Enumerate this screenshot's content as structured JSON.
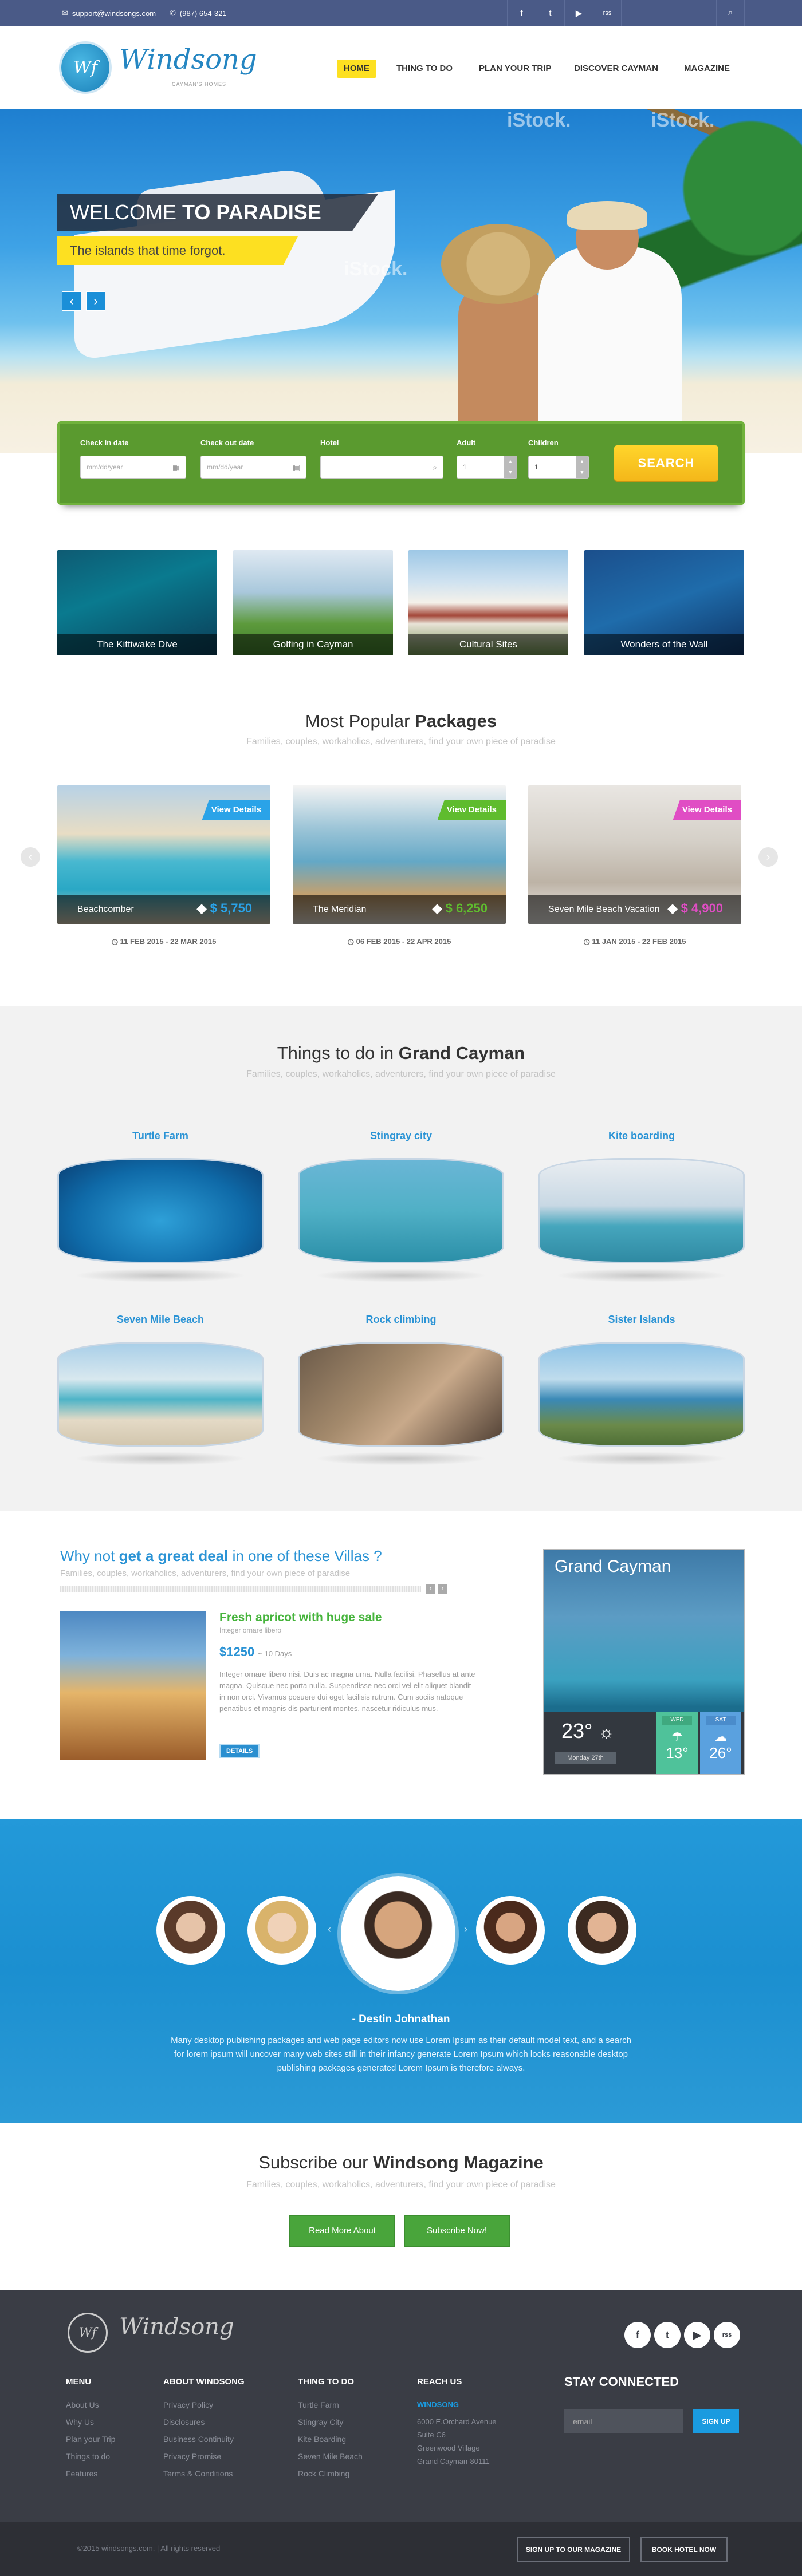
{
  "topbar": {
    "email": "support@windsongs.com",
    "phone": "(987) 654-321",
    "social": [
      "f",
      "t",
      "▶",
      "rss"
    ],
    "icons": {
      "social": [
        "facebook-icon",
        "twitter-icon",
        "youtube-icon",
        "rss-icon"
      ],
      "search": "search-icon"
    }
  },
  "header": {
    "logo_mark": "Wf",
    "logo_text": "Windsong",
    "logo_sub": "CAYMAN'S HOMES",
    "nav": [
      "HOME",
      "THING TO DO",
      "PLAN YOUR TRIP",
      "DISCOVER CAYMAN",
      "MAGAZINE"
    ],
    "active_nav": "HOME",
    "accent": "#fde021"
  },
  "hero": {
    "welcome": "WELCOME",
    "welcome_bold": "TO PARADISE",
    "tagline": "The islands that time forgot.",
    "watermarks": [
      "iStock.",
      "iStock.",
      "iStock."
    ]
  },
  "search": {
    "checkin_label": "Check in date",
    "checkin_placeholder": "mm/dd/year",
    "checkout_label": "Check out date",
    "checkout_placeholder": "mm/dd/year",
    "hotel_label": "Hotel",
    "adult_label": "Adult",
    "adult_value": "1",
    "children_label": "Children",
    "children_value": "1",
    "button": "SEARCH",
    "color": "#5a9a2f"
  },
  "tiles": [
    "The Kittiwake Dive",
    "Golfing in Cayman",
    "Cultural Sites",
    "Wonders of the Wall"
  ],
  "packages": {
    "title": "Most Popular",
    "title_bold": "Packages",
    "subtitle": "Families, couples, workaholics, adventurers, find your own piece of paradise",
    "items": [
      {
        "name": "Beachcomber",
        "price": "$ 5,750",
        "cta": "View Details",
        "dates": "11 FEB 2015 - 22 MAR 2015",
        "color": "#2aa3e8"
      },
      {
        "name": "The Meridian",
        "price": "$ 6,250",
        "cta": "View Details",
        "dates": "06 FEB 2015 - 22 APR 2015",
        "color": "#5fbc2e"
      },
      {
        "name": "Seven Mile Beach Vacation",
        "price": "$ 4,900",
        "cta": "View Details",
        "dates": "11 JAN 2015 - 22 FEB 2015",
        "color": "#e04dc4"
      }
    ]
  },
  "things": {
    "title": "Things to do in",
    "title_bold": "Grand Cayman",
    "subtitle": "Families, couples, workaholics, adventurers, find your own piece of paradise",
    "items": [
      "Turtle Farm",
      "Stingray city",
      "Kite boarding",
      "Seven Mile Beach",
      "Rock climbing",
      "Sister Islands"
    ]
  },
  "deal": {
    "title_pre": "Why not",
    "title_bold": "get a great deal",
    "title_post": "in one of these Villas ?",
    "subtitle": "Families, couples, workaholics, adventurers, find your own piece of paradise",
    "heading": "Fresh apricot with huge sale",
    "small": "Integer ornare libero",
    "price": "$1250",
    "price_unit": "~ 10 Days",
    "body": "Integer ornare libero nisi. Duis ac magna urna. Nulla facilisi. Phasellus at ante magna. Quisque nec porta nulla. Suspendisse nec orci vel elit aliquet blandit in non orci. Vivamus posuere dui eget facilisis rutrum. Cum sociis natoque penatibus et magnis dis parturient montes, nascetur ridiculus mus.",
    "button": "DETAILS"
  },
  "weather": {
    "place": "Grand Cayman",
    "temp": "23°",
    "day": "Monday 27th",
    "wed": "WED",
    "wed_temp": "13°",
    "sat": "SAT",
    "sat_temp": "26°"
  },
  "testimonial": {
    "name": "- Destin Johnathan",
    "quote": "Many desktop publishing packages and web page editors now use Lorem Ipsum as their default model text, and a search for lorem ipsum will uncover many web sites still in their infancy generate Lorem Ipsum which looks reasonable desktop publishing packages generated Lorem Ipsum is therefore always."
  },
  "subscribe": {
    "title": "Subscribe our",
    "title_bold": "Windsong Magazine",
    "subtitle": "Families, couples, workaholics, adventurers, find your own piece of paradise",
    "read_more": "Read More About",
    "subscribe": "Subscribe Now!"
  },
  "footer": {
    "logo_mark": "Wf",
    "logo_text": "Windsong",
    "social": [
      "f",
      "t",
      "▶",
      "rss"
    ],
    "menu_title": "MENU",
    "menu": [
      "About Us",
      "Why Us",
      "Plan your Trip",
      "Things to do",
      "Features"
    ],
    "about_title": "ABOUT WINDSONG",
    "about": [
      "Privacy Policy",
      "Disclosures",
      "Business Continuity",
      "Privacy Promise",
      "Terms & Conditions"
    ],
    "things_title": "THING TO DO",
    "things": [
      "Turtle Farm",
      "Stingray City",
      "Kite Boarding",
      "Seven Mile Beach",
      "Rock Climbing"
    ],
    "reach_title": "REACH US",
    "reach_name": "WINDSONG",
    "reach": [
      "6000 E.Orchard Avenue",
      "Suite C6",
      "Greenwood Village",
      "Grand Cayman-80111"
    ],
    "connected": "STAY CONNECTED",
    "email_placeholder": "email",
    "sign_up": "SIGN UP",
    "copyright": "©2015 windsongs.com. | All rights reserved",
    "magazine_btn": "SIGN UP TO OUR MAGAZINE",
    "book_btn": "BOOK HOTEL NOW"
  }
}
